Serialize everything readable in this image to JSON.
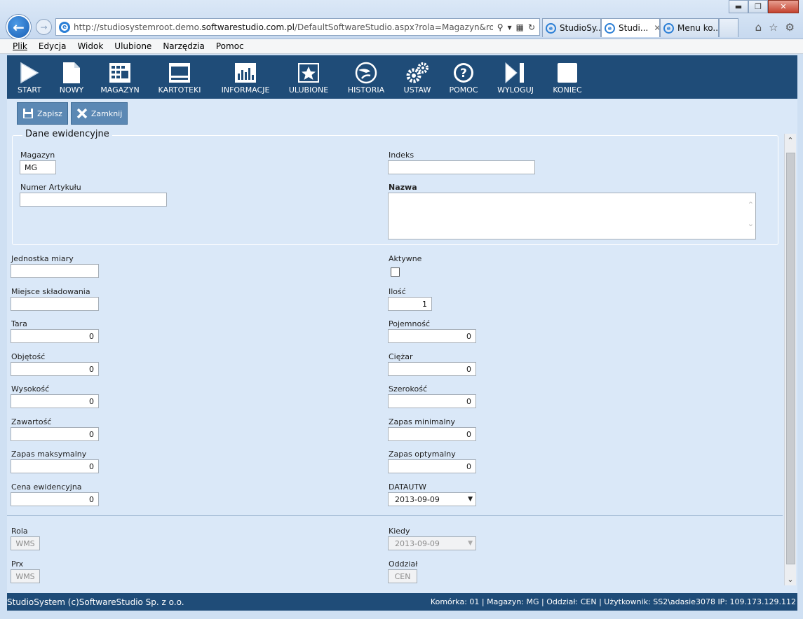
{
  "browser": {
    "url_prefix": "http://studiosystemroot.demo.",
    "url_domain": "softwarestudio.com.pl",
    "url_suffix": "/DefaultSoftwareStudio.aspx?rola=Magazyn&rolasys=WMS",
    "tabs": [
      {
        "label": "StudioSy..."
      },
      {
        "label": "Studi...",
        "active": true
      },
      {
        "label": "Menu ko..."
      }
    ],
    "window_buttons": {
      "minimize": "▬",
      "maximize": "❐",
      "close": "✕"
    }
  },
  "menubar": [
    "Plik",
    "Edycja",
    "Widok",
    "Ulubione",
    "Narzędzia",
    "Pomoc"
  ],
  "toolbar": [
    {
      "label": "START",
      "icon": "play-icon"
    },
    {
      "label": "NOWY",
      "icon": "document-icon"
    },
    {
      "label": "MAGAZYN",
      "icon": "grid-icon"
    },
    {
      "label": "KARTOTEKI",
      "icon": "window-icon"
    },
    {
      "label": "INFORMACJE",
      "icon": "chart-icon"
    },
    {
      "label": "ULUBIONE",
      "icon": "star-icon"
    },
    {
      "label": "HISTORIA",
      "icon": "history-icon"
    },
    {
      "label": "USTAW",
      "icon": "gears-icon"
    },
    {
      "label": "POMOC",
      "icon": "help-icon"
    },
    {
      "label": "WYLOGUJ",
      "icon": "logout-icon"
    },
    {
      "label": "KONIEC",
      "icon": "stop-icon"
    }
  ],
  "actions": {
    "save_label": "Zapisz",
    "close_label": "Zamknij"
  },
  "form": {
    "section_title": "Dane ewidencyjne",
    "magazyn": {
      "label": "Magazyn",
      "value": "MG"
    },
    "indeks": {
      "label": "Indeks",
      "value": ""
    },
    "numer_artykulu": {
      "label": "Numer Artykułu",
      "value": ""
    },
    "nazwa": {
      "label": "Nazwa",
      "value": ""
    },
    "jednostka_miary": {
      "label": "Jednostka miary",
      "value": ""
    },
    "aktywne": {
      "label": "Aktywne",
      "checked": false
    },
    "miejsce_skladowania": {
      "label": "Miejsce składowania",
      "value": ""
    },
    "ilosc": {
      "label": "Ilość",
      "value": "1"
    },
    "tara": {
      "label": "Tara",
      "value": "0"
    },
    "pojemnosc": {
      "label": "Pojemność",
      "value": "0"
    },
    "objetosc": {
      "label": "Objętość",
      "value": "0"
    },
    "ciezar": {
      "label": "Ciężar",
      "value": "0"
    },
    "wysokosc": {
      "label": "Wysokość",
      "value": "0"
    },
    "szerokosc": {
      "label": "Szerokość",
      "value": "0"
    },
    "zawartosc": {
      "label": "Zawartość",
      "value": "0"
    },
    "zapas_minimalny": {
      "label": "Zapas minimalny",
      "value": "0"
    },
    "zapas_maksymalny": {
      "label": "Zapas maksymalny",
      "value": "0"
    },
    "zapas_optymalny": {
      "label": "Zapas optymalny",
      "value": "0"
    },
    "cena_ewidencyjna": {
      "label": "Cena ewidencyjna",
      "value": "0"
    },
    "datautw": {
      "label": "DATAUTW",
      "value": "2013-09-09"
    },
    "rola": {
      "label": "Rola",
      "value": "WMS"
    },
    "kiedy": {
      "label": "Kiedy",
      "value": "2013-09-09"
    },
    "prx": {
      "label": "Prx",
      "value": "WMS"
    },
    "oddzial": {
      "label": "Oddział",
      "value": "CEN"
    }
  },
  "status": {
    "left": "StudioSystem (c)SoftwareStudio Sp. z o.o.",
    "right": "Komórka: 01 | Magazyn: MG | Oddział: CEN | Użytkownik: SS2\\adasie3078 IP: 109.173.129.112"
  }
}
